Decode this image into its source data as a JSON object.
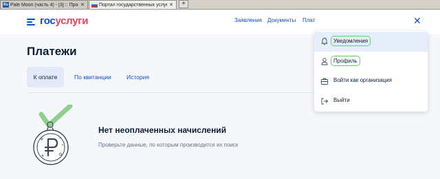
{
  "browser": {
    "tabs": [
      {
        "label": "Pale Moon (часть 4) - [3] :: Программы ..."
      },
      {
        "label": "Портал государственных услуг Россий..."
      }
    ]
  },
  "header": {
    "logo_part1": "гос",
    "logo_part2": "услуги",
    "nav": [
      "Заявления",
      "Документы",
      "Плат"
    ]
  },
  "page": {
    "title": "Платежи",
    "tabs": [
      "К оплате",
      "По квитанции",
      "История"
    ],
    "active_tab": "К оплате",
    "empty_title": "Нет неоплаченных начислений",
    "empty_subtitle": "Проверьте данные, по которым производится их поиск"
  },
  "menu": {
    "items": [
      {
        "label": "Уведомления",
        "icon": "bell-icon"
      },
      {
        "label": "Профиль",
        "icon": "person-icon"
      },
      {
        "label": "Войти как организация",
        "icon": "briefcase-icon"
      },
      {
        "label": "Выйти",
        "icon": "logout-icon"
      }
    ]
  },
  "colors": {
    "brand_blue": "#0d4cd3",
    "brand_red": "#ee3f58",
    "check_green": "#8fd18a",
    "highlight_outline": "#5fd55f"
  }
}
